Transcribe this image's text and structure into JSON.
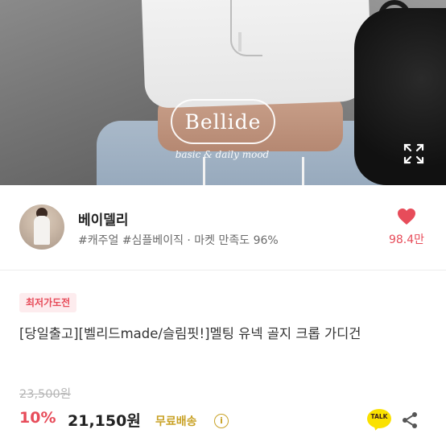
{
  "hero": {
    "logo_text": "Bellide",
    "tagline": "basic & daily mood",
    "expand_icon": "expand-icon"
  },
  "seller": {
    "name": "베이델리",
    "meta": "#캐주얼 #심플베이직 · 마켓 만족도 96%",
    "like_icon": "heart-icon",
    "like_count": "98.4만"
  },
  "product": {
    "badge": "최저가도전",
    "title": "[당일출고][벨리드made/슬림핏!]멜팅 유넥 골지 크롭 가디건",
    "original_price": "23,500원",
    "discount": "10%",
    "price": "21,150원",
    "shipping": "무료배송",
    "info_icon": "info-icon",
    "info_glyph": "i"
  },
  "actions": {
    "talk_label": "TALK",
    "share_icon": "share-icon"
  },
  "colors": {
    "accent": "#e74c5a",
    "shipping": "#c9a227",
    "talk": "#fae100"
  }
}
